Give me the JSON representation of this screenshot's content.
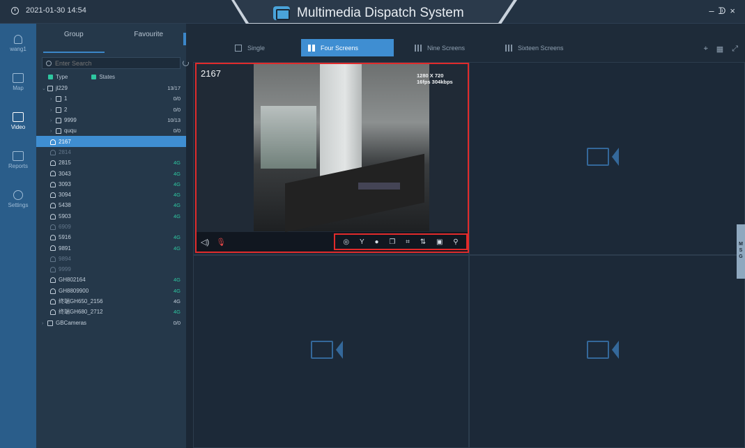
{
  "titlebar": {
    "datetime": "2021-01-30 14:54",
    "app_title": "Multimedia Dispatch System",
    "minimize": "–",
    "restore": "ᗫ",
    "close": "×"
  },
  "rail": {
    "user": "wang1",
    "items": [
      {
        "label": "Map",
        "icon": "map-icon"
      },
      {
        "label": "Video",
        "icon": "video-icon"
      },
      {
        "label": "Reports",
        "icon": "reports-icon"
      },
      {
        "label": "Settings",
        "icon": "settings-icon"
      }
    ]
  },
  "panel": {
    "tabs": [
      "Group",
      "Favourite"
    ],
    "search_placeholder": "Enter Search",
    "filters": {
      "type": "Type",
      "states": "States"
    },
    "tree": [
      {
        "label": "jl229",
        "value": "13/17",
        "kind": "group",
        "indent": 0,
        "expanded": true
      },
      {
        "label": "1",
        "value": "0/0",
        "kind": "group",
        "indent": 1
      },
      {
        "label": "2",
        "value": "0/0",
        "kind": "group",
        "indent": 1
      },
      {
        "label": "9999",
        "value": "10/13",
        "kind": "vehicle",
        "indent": 1
      },
      {
        "label": "ququ",
        "value": "0/0",
        "kind": "vehicle",
        "indent": 1
      },
      {
        "label": "2167",
        "value": "",
        "kind": "user",
        "indent": 1,
        "selected": true
      },
      {
        "label": "2814",
        "value": "",
        "kind": "user",
        "indent": 1,
        "dim": true
      },
      {
        "label": "2815",
        "value": "4G",
        "kind": "user",
        "indent": 1
      },
      {
        "label": "3043",
        "value": "4G",
        "kind": "user",
        "indent": 1
      },
      {
        "label": "3093",
        "value": "4G",
        "kind": "user",
        "indent": 1
      },
      {
        "label": "3094",
        "value": "4G",
        "kind": "user",
        "indent": 1
      },
      {
        "label": "5438",
        "value": "4G",
        "kind": "user",
        "indent": 1
      },
      {
        "label": "5903",
        "value": "4G",
        "kind": "user",
        "indent": 1
      },
      {
        "label": "6909",
        "value": "",
        "kind": "user",
        "indent": 1,
        "dim": true
      },
      {
        "label": "5916",
        "value": "4G",
        "kind": "user",
        "indent": 1
      },
      {
        "label": "9891",
        "value": "4G",
        "kind": "user",
        "indent": 1
      },
      {
        "label": "9894",
        "value": "",
        "kind": "user",
        "indent": 1,
        "dim": true
      },
      {
        "label": "9999",
        "value": "",
        "kind": "user",
        "indent": 1,
        "dim": true
      },
      {
        "label": "GH802164",
        "value": "4G",
        "kind": "user",
        "indent": 1
      },
      {
        "label": "GH8809900",
        "value": "4G",
        "kind": "user",
        "indent": 1
      },
      {
        "label": "终端GH650_2156",
        "value": "4G",
        "kind": "user",
        "indent": 1,
        "plain_value": true
      },
      {
        "label": "终端GH680_2712",
        "value": "4G",
        "kind": "user",
        "indent": 1
      },
      {
        "label": "GBCameras",
        "value": "0/0",
        "kind": "group",
        "indent": 0
      }
    ]
  },
  "toolbar": {
    "modes": [
      {
        "label": "Single",
        "icon": "single-screen-icon"
      },
      {
        "label": "Four Screens",
        "icon": "four-screens-icon",
        "active": true
      },
      {
        "label": "Nine Screens",
        "icon": "nine-screens-icon"
      },
      {
        "label": "Sixteen Screens",
        "icon": "sixteen-screens-icon"
      }
    ]
  },
  "video": {
    "name": "2167",
    "resolution": "1280 X 720",
    "stream": "16fps 304kbps",
    "controls": [
      "snapshot-icon",
      "antenna-icon",
      "record-icon",
      "copy-icon",
      "crop-icon",
      "flip-icon",
      "lock-icon",
      "pin-icon"
    ]
  },
  "side_tab": [
    "M",
    "S",
    "G"
  ]
}
